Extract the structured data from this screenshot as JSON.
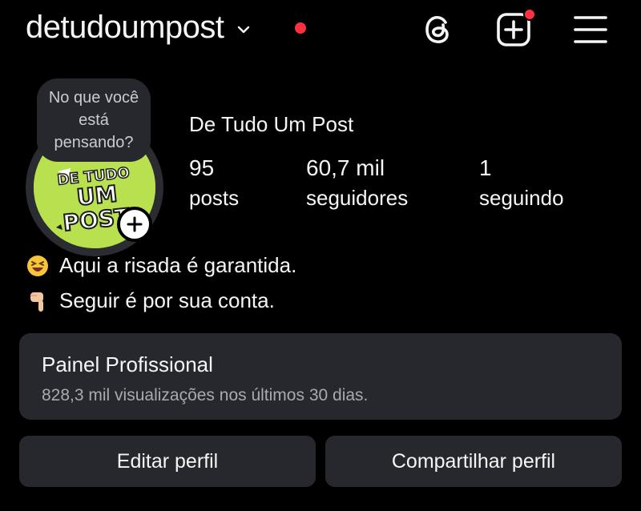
{
  "header": {
    "username": "detudoumpost",
    "icons": [
      "chevron-down-icon",
      "threads-icon",
      "create-post-icon",
      "menu-icon"
    ],
    "notification_dot_color": "#ff3040"
  },
  "avatar": {
    "note_text": "No que você está pensando?",
    "logo_text_top": "DE TUDO",
    "logo_text_mid": "UM",
    "logo_text_bottom": "POST",
    "logo_background": "#b9e04f",
    "add_icon": "plus-icon"
  },
  "profile": {
    "display_name": "De Tudo Um Post",
    "stats": [
      {
        "value": "95",
        "label": "posts"
      },
      {
        "value": "60,7 mil",
        "label": "seguidores"
      },
      {
        "value": "1",
        "label": "seguindo"
      }
    ],
    "bio": [
      {
        "icon": "laughing-emoji-icon",
        "text": "Aqui a risada é garantida."
      },
      {
        "icon": "pointing-down-emoji-icon",
        "text": "Seguir é por sua conta."
      }
    ]
  },
  "dashboard": {
    "title": "Painel Profissional",
    "subtitle": "828,3 mil visualizações nos últimos 30 dias."
  },
  "actions": {
    "edit_label": "Editar perfil",
    "share_label": "Compartilhar perfil"
  },
  "colors": {
    "background": "#000000",
    "surface": "#26282d",
    "text": "#f5f5f5",
    "muted": "#a8aab0"
  }
}
